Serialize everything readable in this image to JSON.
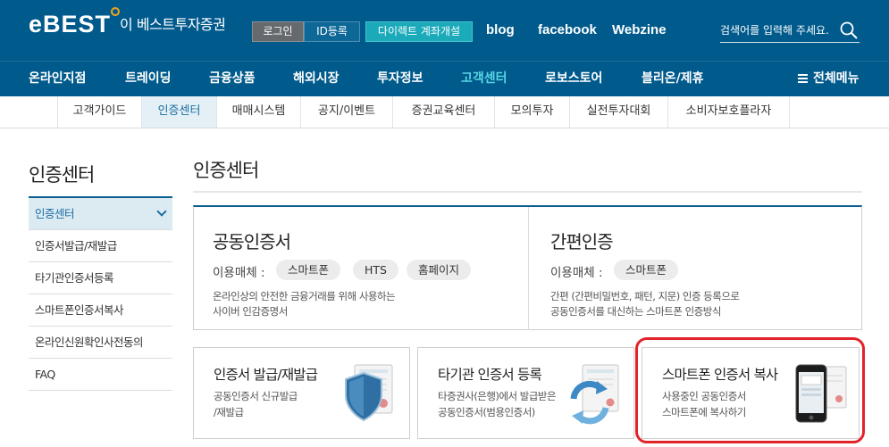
{
  "header": {
    "brand_mark": "eBEST",
    "brand_name": "이 베스트투자증권",
    "login_label": "로그인",
    "id_register_label": "ID등록",
    "open_account_label": "다이렉트 계좌개설",
    "links": {
      "blog": "blog",
      "facebook": "facebook",
      "webzine": "Webzine"
    },
    "search_placeholder": "검색어를 입력해 주세요."
  },
  "main_nav": {
    "items": [
      "온라인지점",
      "트레이딩",
      "금융상품",
      "해외시장",
      "투자정보",
      "고객센터",
      "로보스토어",
      "블리온/제휴"
    ],
    "active": "고객센터",
    "all_menu_label": "전체메뉴"
  },
  "sub_nav": {
    "items": [
      "고객가이드",
      "인증센터",
      "매매시스템",
      "공지/이벤트",
      "증권교육센터",
      "모의투자",
      "실전투자대회",
      "소비자보호플라자"
    ],
    "active": "인증센터"
  },
  "sidebar": {
    "title": "인증센터",
    "items": [
      "인증센터",
      "인증서발급/재발급",
      "타기관인증서등록",
      "스마트폰인증서복사",
      "온라인신원확인사전동의",
      "FAQ"
    ],
    "active": "인증센터"
  },
  "main": {
    "title": "인증센터",
    "cert_panel": {
      "title": "공동인증서",
      "media_label": "이용매체 :",
      "media": [
        "스마트폰",
        "HTS",
        "홈페이지"
      ],
      "desc": [
        "온라인상의 안전한 금융거래를 위해 사용하는",
        "사이버 인감증명서"
      ]
    },
    "simple_panel": {
      "title": "간편인증",
      "media_label": "이용매체 :",
      "media": [
        "스마트폰"
      ],
      "desc": [
        "간편 (간편비밀번호, 패턴, 지문) 인증 등록으로",
        "공동인증서를 대신하는 스마트폰 인증방식"
      ]
    },
    "cards": [
      {
        "title": "인증서 발급/재발급",
        "desc": [
          "공동인증서 신규발급",
          "/재발급"
        ],
        "icon": "shield-certificate-icon"
      },
      {
        "title": "타기관 인증서 등록",
        "desc": [
          "타증권사(은행)에서 발급받은",
          "공동인증서(범용인증서)"
        ],
        "icon": "sync-certificate-icon"
      },
      {
        "title": "스마트폰 인증서 복사",
        "desc": [
          "사용중인 공동인증서",
          "스마트폰에 복사하기"
        ],
        "icon": "smartphone-certificate-icon"
      }
    ]
  },
  "colors": {
    "header_bg": "#005a8c",
    "active_nav": "#58d6e4",
    "account_button": "#1aaaba",
    "highlight_border": "#e2232a"
  }
}
